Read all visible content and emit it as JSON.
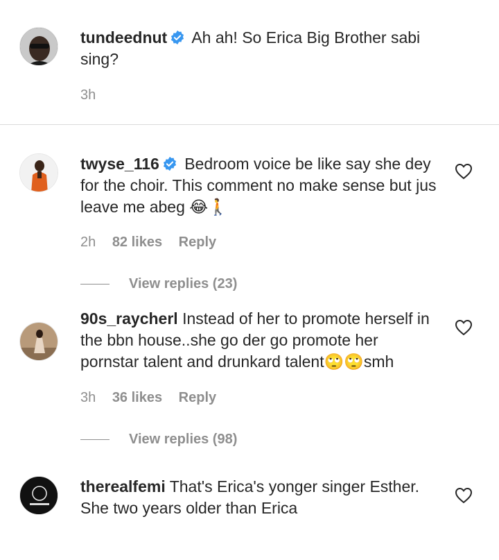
{
  "caption": {
    "username": "tundeednut",
    "text": "Ah ah! So Erica Big Brother sabi sing?",
    "time": "3h"
  },
  "comments": [
    {
      "username": "twyse_116",
      "text": "Bedroom voice be like say she dey for the choir. This comment no make sense but jus leave me abeg 😂🚶",
      "time": "2h",
      "likes": "82 likes",
      "reply": "Reply",
      "view_replies": "View replies (23)"
    },
    {
      "username": "90s_raycherl",
      "text": "Instead of her to promote herself in the bbn house..she go der go promote her pornstar talent and drunkard talent🙄🙄smh",
      "time": "3h",
      "likes": "36 likes",
      "reply": "Reply",
      "view_replies": "View replies (98)"
    },
    {
      "username": "therealfemi",
      "text": "That's Erica's yonger singer Esther. She two years older than Erica"
    }
  ],
  "colors": {
    "verified_badge": "#3897f0",
    "muted_text": "#8e8e8e",
    "divider": "#dbdbdb"
  },
  "icons": {
    "verified": "verified-badge-icon",
    "like": "heart-outline-icon"
  }
}
